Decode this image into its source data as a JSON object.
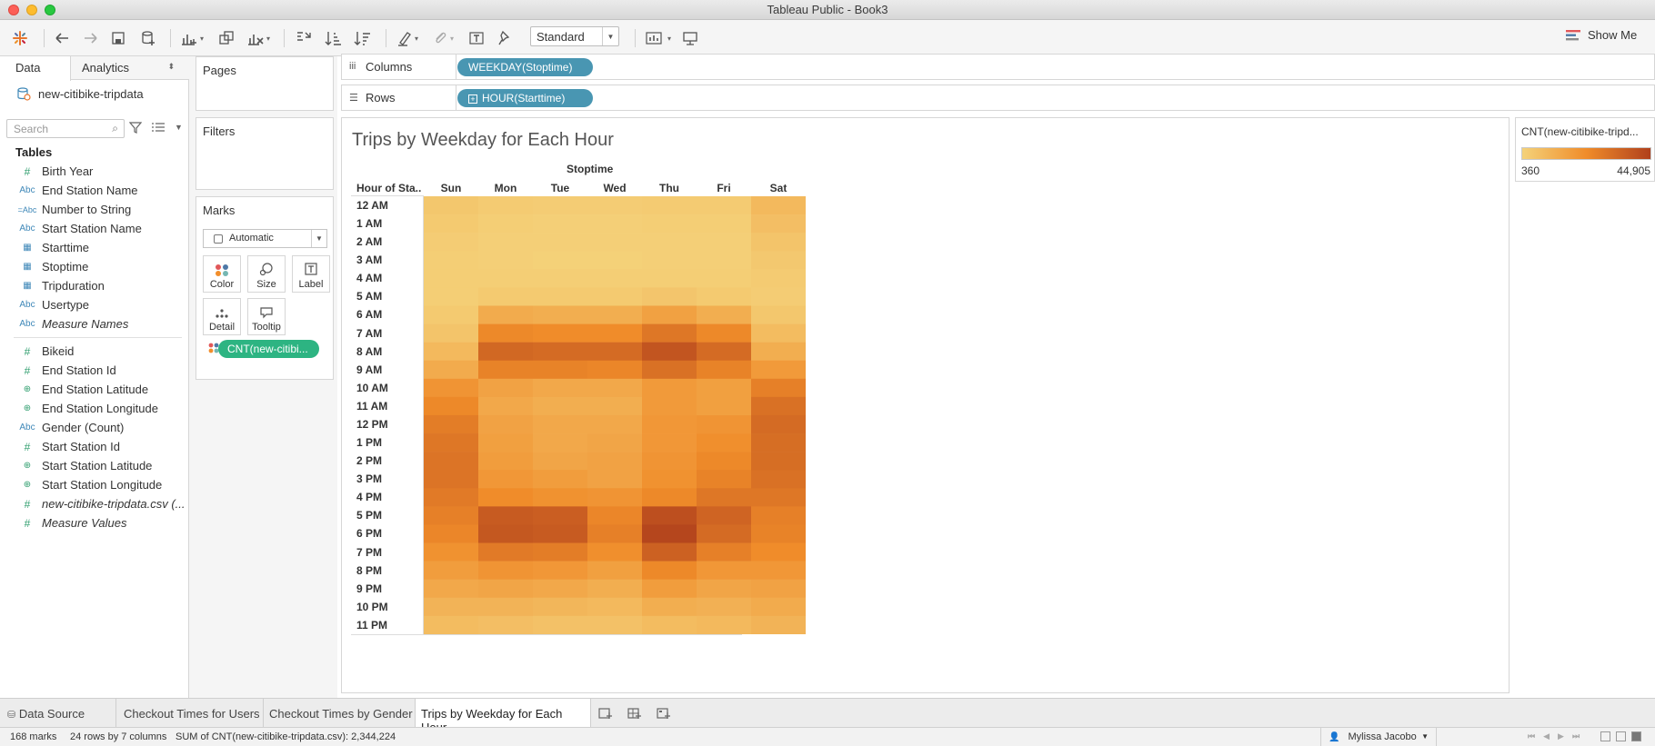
{
  "window": {
    "title": "Tableau Public - Book3"
  },
  "toolbar": {
    "fit": "Standard",
    "show_me": "Show Me"
  },
  "data_pane": {
    "tabs": {
      "data": "Data",
      "analytics": "Analytics"
    },
    "datasource": "new-citibike-tripdata",
    "search_placeholder": "Search",
    "tables_header": "Tables",
    "fields_dims": [
      {
        "icon": "#",
        "name": "Birth Year",
        "kind": "measure"
      },
      {
        "icon": "Abc",
        "name": "End Station Name",
        "kind": "dim"
      },
      {
        "icon": "=Abc",
        "name": "Number to String",
        "kind": "dim"
      },
      {
        "icon": "Abc",
        "name": "Start Station Name",
        "kind": "dim"
      },
      {
        "icon": "date",
        "name": "Starttime",
        "kind": "dim"
      },
      {
        "icon": "date",
        "name": "Stoptime",
        "kind": "dim"
      },
      {
        "icon": "date",
        "name": "Tripduration",
        "kind": "dim"
      },
      {
        "icon": "Abc",
        "name": "Usertype",
        "kind": "dim"
      },
      {
        "icon": "Abc",
        "name": "Measure Names",
        "kind": "dim",
        "italic": true
      }
    ],
    "fields_meas": [
      {
        "icon": "#",
        "name": "Bikeid",
        "kind": "measure"
      },
      {
        "icon": "#",
        "name": "End Station Id",
        "kind": "measure"
      },
      {
        "icon": "globe",
        "name": "End Station Latitude",
        "kind": "measure"
      },
      {
        "icon": "globe",
        "name": "End Station Longitude",
        "kind": "measure"
      },
      {
        "icon": "Abc",
        "name": "Gender (Count)",
        "kind": "dim"
      },
      {
        "icon": "#",
        "name": "Start Station Id",
        "kind": "measure"
      },
      {
        "icon": "globe",
        "name": "Start Station Latitude",
        "kind": "measure"
      },
      {
        "icon": "globe",
        "name": "Start Station Longitude",
        "kind": "measure"
      },
      {
        "icon": "#",
        "name": "new-citibike-tripdata.csv (...",
        "kind": "measure",
        "italic": true
      },
      {
        "icon": "#",
        "name": "Measure Values",
        "kind": "measure",
        "italic": true
      }
    ]
  },
  "cards": {
    "pages": "Pages",
    "filters": "Filters",
    "marks": "Marks",
    "mark_type": "Automatic",
    "color": "Color",
    "size": "Size",
    "label": "Label",
    "detail": "Detail",
    "tooltip": "Tooltip",
    "color_pill": "CNT(new-citibi..."
  },
  "shelves": {
    "columns_label": "Columns",
    "columns_pill": "WEEKDAY(Stoptime)",
    "rows_label": "Rows",
    "rows_pill": "HOUR(Starttime)"
  },
  "viz": {
    "title": "Trips by Weekday for Each Hour",
    "col_group": "Stoptime",
    "row_title": "Hour of Sta..",
    "days": [
      "Sun",
      "Mon",
      "Tue",
      "Wed",
      "Thu",
      "Fri",
      "Sat"
    ],
    "hours": [
      "12 AM",
      "1 AM",
      "2 AM",
      "3 AM",
      "4 AM",
      "5 AM",
      "6 AM",
      "7 AM",
      "8 AM",
      "9 AM",
      "10 AM",
      "11 AM",
      "12 PM",
      "1 PM",
      "2 PM",
      "3 PM",
      "4 PM",
      "5 PM",
      "6 PM",
      "7 PM",
      "8 PM",
      "9 PM",
      "10 PM",
      "11 PM"
    ],
    "levels": [
      [
        0.08,
        0.05,
        0.04,
        0.04,
        0.05,
        0.05,
        0.18
      ],
      [
        0.06,
        0.03,
        0.02,
        0.02,
        0.03,
        0.03,
        0.14
      ],
      [
        0.04,
        0.02,
        0.02,
        0.02,
        0.02,
        0.02,
        0.1
      ],
      [
        0.03,
        0.02,
        0.01,
        0.01,
        0.02,
        0.02,
        0.07
      ],
      [
        0.03,
        0.03,
        0.03,
        0.03,
        0.03,
        0.03,
        0.05
      ],
      [
        0.03,
        0.06,
        0.06,
        0.06,
        0.09,
        0.06,
        0.04
      ],
      [
        0.06,
        0.28,
        0.26,
        0.26,
        0.35,
        0.26,
        0.08
      ],
      [
        0.1,
        0.52,
        0.5,
        0.5,
        0.64,
        0.52,
        0.16
      ],
      [
        0.18,
        0.74,
        0.72,
        0.72,
        0.86,
        0.72,
        0.26
      ],
      [
        0.28,
        0.56,
        0.56,
        0.54,
        0.68,
        0.56,
        0.4
      ],
      [
        0.44,
        0.34,
        0.3,
        0.3,
        0.4,
        0.36,
        0.58
      ],
      [
        0.52,
        0.3,
        0.26,
        0.26,
        0.4,
        0.36,
        0.68
      ],
      [
        0.6,
        0.34,
        0.3,
        0.3,
        0.42,
        0.44,
        0.72
      ],
      [
        0.64,
        0.36,
        0.3,
        0.32,
        0.42,
        0.48,
        0.7
      ],
      [
        0.66,
        0.38,
        0.32,
        0.34,
        0.44,
        0.52,
        0.7
      ],
      [
        0.66,
        0.42,
        0.38,
        0.34,
        0.46,
        0.56,
        0.68
      ],
      [
        0.62,
        0.5,
        0.46,
        0.44,
        0.52,
        0.64,
        0.64
      ],
      [
        0.58,
        0.82,
        0.8,
        0.54,
        0.9,
        0.76,
        0.58
      ],
      [
        0.54,
        0.84,
        0.82,
        0.58,
        0.96,
        0.72,
        0.56
      ],
      [
        0.46,
        0.62,
        0.6,
        0.48,
        0.78,
        0.58,
        0.5
      ],
      [
        0.38,
        0.44,
        0.42,
        0.36,
        0.52,
        0.42,
        0.42
      ],
      [
        0.3,
        0.32,
        0.3,
        0.26,
        0.38,
        0.32,
        0.34
      ],
      [
        0.22,
        0.22,
        0.2,
        0.18,
        0.26,
        0.24,
        0.28
      ],
      [
        0.16,
        0.14,
        0.12,
        0.12,
        0.16,
        0.18,
        0.22
      ]
    ]
  },
  "legend": {
    "title": "CNT(new-citibike-tripd...",
    "min": "360",
    "max": "44,905",
    "color_low": "#f4d27a",
    "color_mid": "#f08c2a",
    "color_high": "#b0401c"
  },
  "sheet_tabs": {
    "data_source": "Data Source",
    "tab1": "Checkout Times for Users",
    "tab2": "Checkout Times by Gender",
    "tab3": "Trips by Weekday for Each Hour"
  },
  "status": {
    "marks": "168 marks",
    "dims": "24 rows by 7 columns",
    "sum": "SUM of CNT(new-citibike-tripdata.csv): 2,344,224",
    "user": "Mylissa Jacobo"
  }
}
